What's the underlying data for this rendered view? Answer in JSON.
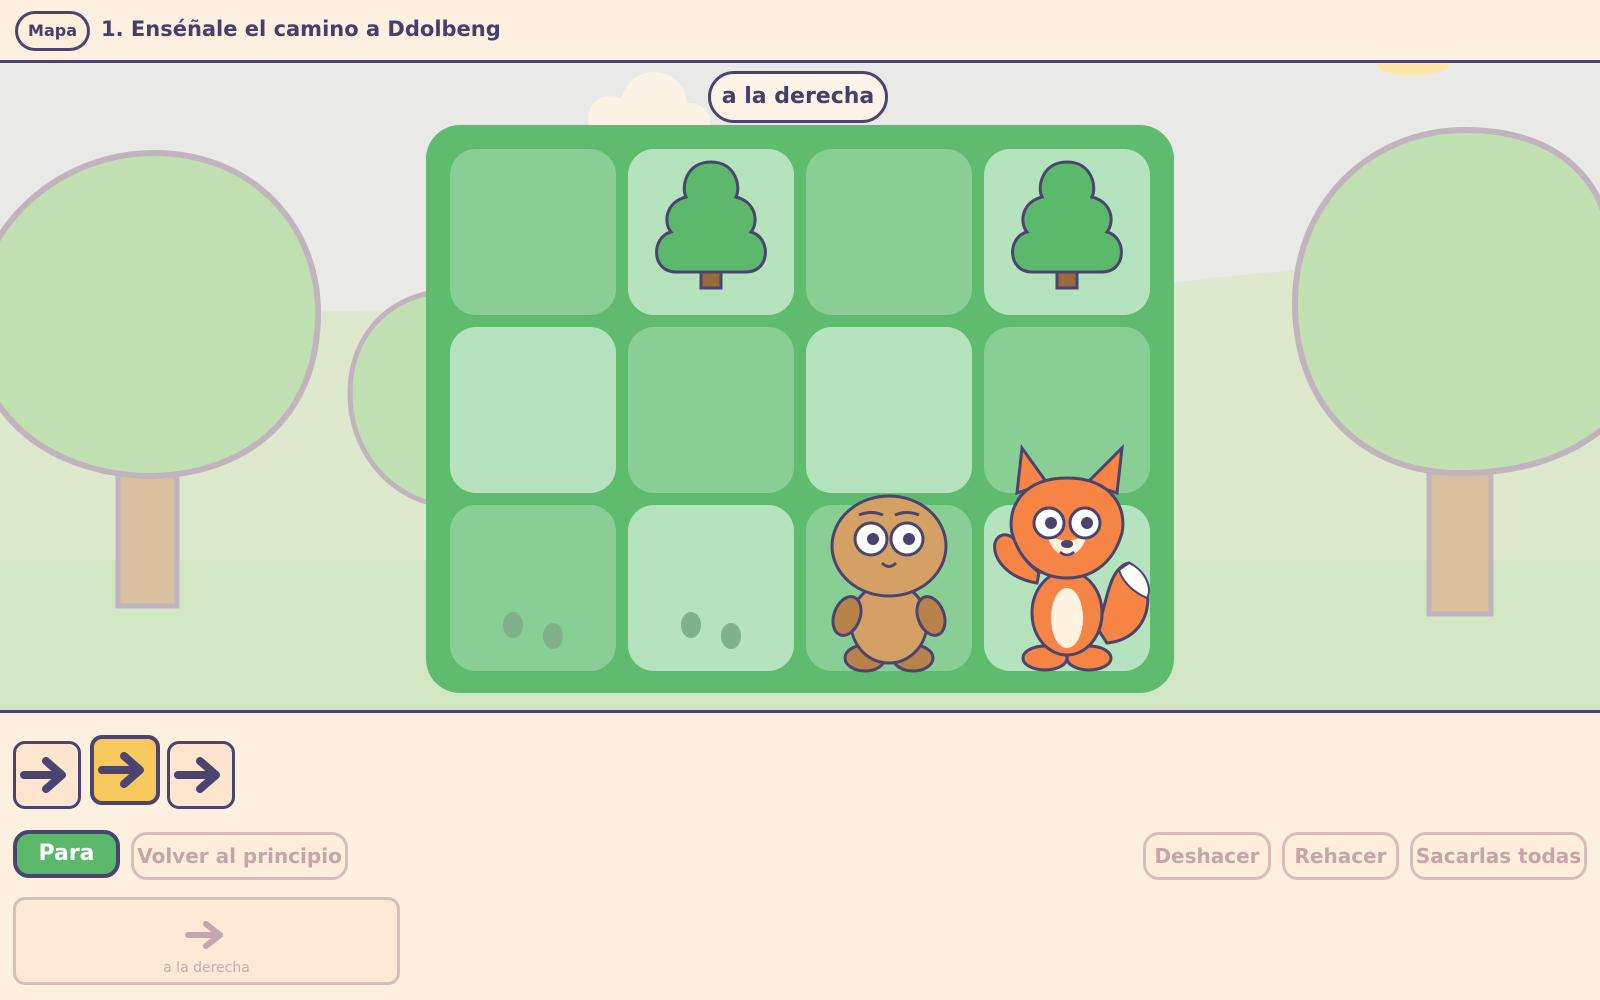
{
  "header": {
    "map_label": "Mapa",
    "level_title": "1. Enséñale el camino a Ddolbeng"
  },
  "scene": {
    "hint_label": "a la derecha",
    "board": {
      "rows": 3,
      "cols": 4,
      "cells": [
        [
          "empty",
          "tree",
          "empty",
          "tree"
        ],
        [
          "empty",
          "empty",
          "empty",
          "empty"
        ],
        [
          "footprints",
          "footprints",
          "player",
          "goal"
        ]
      ]
    },
    "characters": {
      "player": "ddolbeng-character",
      "goal": "fox-character"
    },
    "colors": {
      "board": "#5fbc6e",
      "tile_dark": "#89cf95",
      "tile_light": "#b4e3bd",
      "outline": "#4a446e",
      "fox": "#f58445",
      "player": "#d4a064"
    }
  },
  "commands": {
    "sequence": [
      {
        "icon": "arrow-right-icon",
        "active": false
      },
      {
        "icon": "arrow-right-icon",
        "active": true
      },
      {
        "icon": "arrow-right-icon",
        "active": false
      }
    ]
  },
  "controls": {
    "run_label": "Para",
    "reset_label": "Volver al principio",
    "undo_label": "Deshacer",
    "redo_label": "Rehacer",
    "clear_label": "Sacarlas todas"
  },
  "palette": {
    "blocks": [
      {
        "icon": "arrow-right-icon",
        "label": "a la derecha"
      }
    ]
  }
}
